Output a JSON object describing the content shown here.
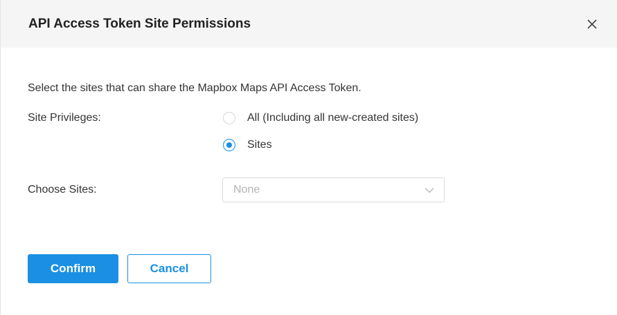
{
  "dialog": {
    "title": "API Access Token Site Permissions",
    "close_icon": "close-icon",
    "intro": "Select the sites that can share the Mapbox Maps API Access Token."
  },
  "site_privileges": {
    "label": "Site Privileges:",
    "options": [
      {
        "label": "All (Including all new-created sites)",
        "checked": false
      },
      {
        "label": "Sites",
        "checked": true
      }
    ]
  },
  "choose_sites": {
    "label": "Choose Sites:",
    "value": "None",
    "icon": "chevron-down-icon"
  },
  "footer": {
    "confirm_label": "Confirm",
    "cancel_label": "Cancel"
  },
  "colors": {
    "accent": "#1a8fe3",
    "header_bg": "#f5f5f5",
    "placeholder": "#b3b3b3"
  }
}
